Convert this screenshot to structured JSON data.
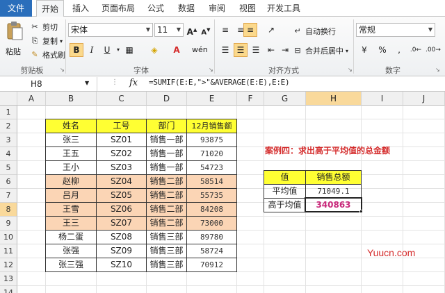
{
  "tabs": [
    "文件",
    "开始",
    "插入",
    "页面布局",
    "公式",
    "数据",
    "审阅",
    "视图",
    "开发工具"
  ],
  "ribbon": {
    "clipboard": {
      "paste": "粘贴",
      "cut": "剪切",
      "copy": "复制",
      "format_painter": "格式刷",
      "group": "剪贴板"
    },
    "font": {
      "name": "宋体",
      "size": "11",
      "group": "字体",
      "phonetic": "wén"
    },
    "alignment": {
      "wrap": "自动换行",
      "merge": "合并后居中",
      "group": "对齐方式"
    },
    "number": {
      "format": "常规",
      "group": "数字",
      "percent": "%",
      "comma": ","
    }
  },
  "formula_bar": {
    "cell_ref": "H8",
    "fx": "fx",
    "formula": "=SUMIF(E:E,\">\"&AVERAGE(E:E),E:E)"
  },
  "columns": [
    "A",
    "B",
    "C",
    "D",
    "E",
    "F",
    "G",
    "H",
    "I",
    "J"
  ],
  "rows": [
    "1",
    "2",
    "3",
    "4",
    "5",
    "6",
    "7",
    "8",
    "9",
    "10",
    "11",
    "12",
    "13",
    "14"
  ],
  "table": {
    "headers": [
      "姓名",
      "工号",
      "部门",
      "12月销售额"
    ],
    "rows": [
      [
        "张三",
        "SZ01",
        "销售一部",
        "93875"
      ],
      [
        "王五",
        "SZ02",
        "销售一部",
        "71020"
      ],
      [
        "王小",
        "SZ03",
        "销售一部",
        "54723"
      ],
      [
        "赵柳",
        "SZ04",
        "销售二部",
        "58514"
      ],
      [
        "吕月",
        "SZ05",
        "销售二部",
        "55735"
      ],
      [
        "王雪",
        "SZ06",
        "销售二部",
        "84208"
      ],
      [
        "王三",
        "SZ07",
        "销售二部",
        "73000"
      ],
      [
        "杨二蛋",
        "SZ08",
        "销售三部",
        "89780"
      ],
      [
        "张强",
        "SZ09",
        "销售三部",
        "58724"
      ],
      [
        "张三强",
        "SZ10",
        "销售三部",
        "70912"
      ]
    ]
  },
  "case_title": "案例四：求出高于平均值的总金额",
  "result_table": {
    "headers": [
      "值",
      "销售总额"
    ],
    "rows": [
      [
        "平均值",
        "71049.1"
      ],
      [
        "高于均值",
        "340863"
      ]
    ]
  },
  "watermark": "Yuucn.com",
  "colors": {
    "header_yellow": "#ffff33",
    "highlight_orange": "#fbd5b5",
    "selected_header": "#f9d99b",
    "accent_red": "#d42a2a",
    "file_tab": "#2a6ebb"
  }
}
